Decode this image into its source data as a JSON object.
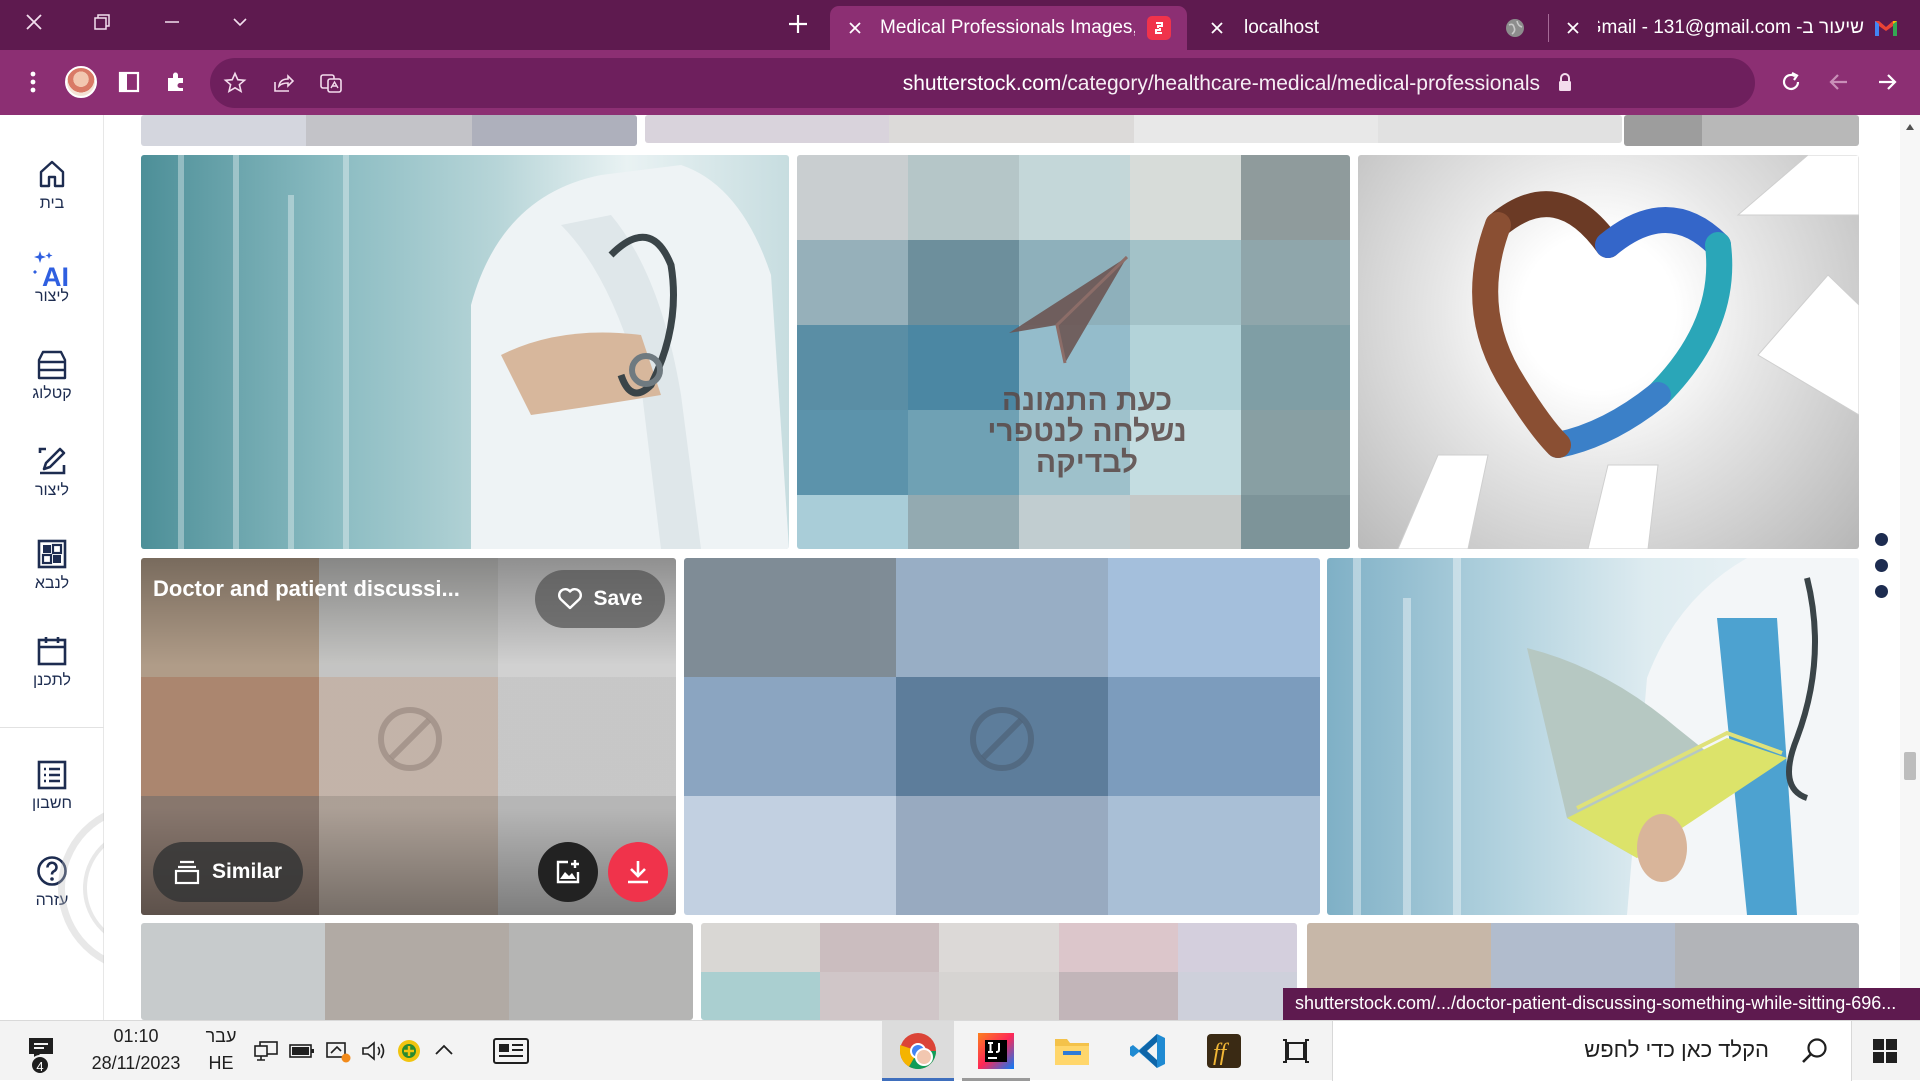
{
  "tabs": [
    {
      "title": "Medical Professionals Images, Pi",
      "active": true,
      "favicon": "shutterstock-icon"
    },
    {
      "title": "localhost",
      "active": false,
      "favicon": "globe-icon"
    },
    {
      "title": "שיעור ב- Gmail - 131@gmail.com",
      "active": false,
      "favicon": "gmail-icon"
    }
  ],
  "toolbar": {
    "url_host": "shutterstock.com",
    "url_path": "/category/healthcare-medical/medical-professionals"
  },
  "sidebar": {
    "items": [
      {
        "label": "בית",
        "icon": "home-icon"
      },
      {
        "label": "ליצור",
        "icon": "ai-create-icon",
        "badge": "AI"
      },
      {
        "label": "קטלוג",
        "icon": "catalog-icon"
      },
      {
        "label": "ליצור",
        "icon": "edit-icon"
      },
      {
        "label": "לנבא",
        "icon": "grid-icon"
      },
      {
        "label": "לתכנן",
        "icon": "calendar-icon"
      },
      {
        "label": "חשבון",
        "icon": "account-list-icon"
      },
      {
        "label": "עזרה",
        "icon": "help-icon"
      }
    ]
  },
  "content": {
    "blocked_text": [
      "כעת התמונה",
      "נשלחה לנטפרי",
      "לבדיקה"
    ],
    "hover_card": {
      "title": "Doctor and patient discussi...",
      "save_label": "Save",
      "similar_label": "Similar"
    }
  },
  "status_url": "shutterstock.com/.../doctor-patient-discussing-something-while-sitting-696...",
  "taskbar": {
    "notification_count": "4",
    "time": "01:10",
    "date": "28/11/2023",
    "lang_top": "עבר",
    "lang_bottom": "HE",
    "search_placeholder": "הקלד כאן כדי לחפש"
  },
  "colors": {
    "titlebar": "#5e1a4f",
    "toolbar": "#8c2f73",
    "accent_red": "#f0334b",
    "sidebar_text": "#1d2c50"
  }
}
